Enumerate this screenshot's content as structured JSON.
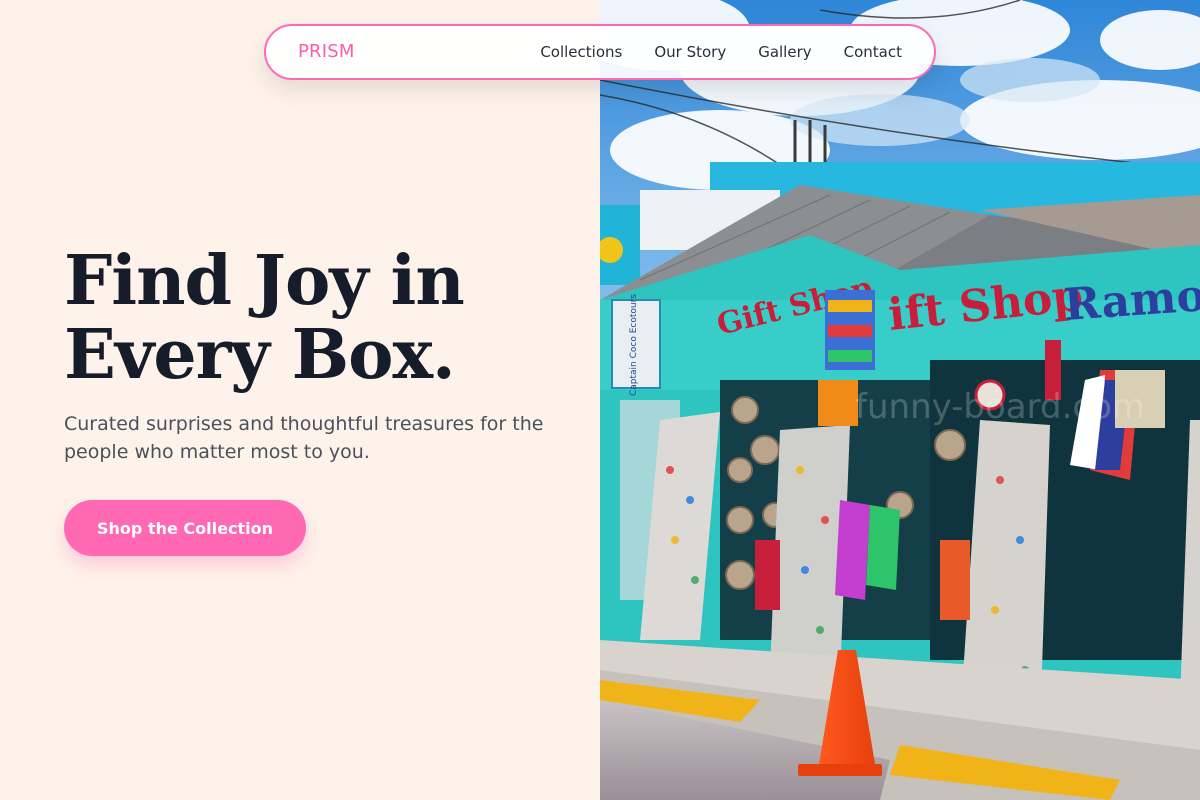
{
  "brand": {
    "name": "PRISM",
    "accent_color": "#ff69b4"
  },
  "nav": {
    "links": [
      {
        "label": "Collections"
      },
      {
        "label": "Our Story"
      },
      {
        "label": "Gallery"
      },
      {
        "label": "Contact"
      }
    ]
  },
  "hero": {
    "title_line_1": "Find Joy in",
    "title_line_2": "Every Box.",
    "subtitle": "Curated surprises and thoughtful treasures for the people who matter most to you.",
    "cta_label": "Shop the Collection"
  },
  "photo": {
    "signs": {
      "left": "Gift Shop",
      "center": "ift Shop",
      "right": "Ramon"
    },
    "small_sign": "Captain Coco Ecotours",
    "watermark": "funny-board.com"
  },
  "colors": {
    "page_background": "#fdf3ea",
    "heading": "#171c2b",
    "body_text": "#4b505c",
    "shop_turquoise": "#2ec4c0"
  }
}
